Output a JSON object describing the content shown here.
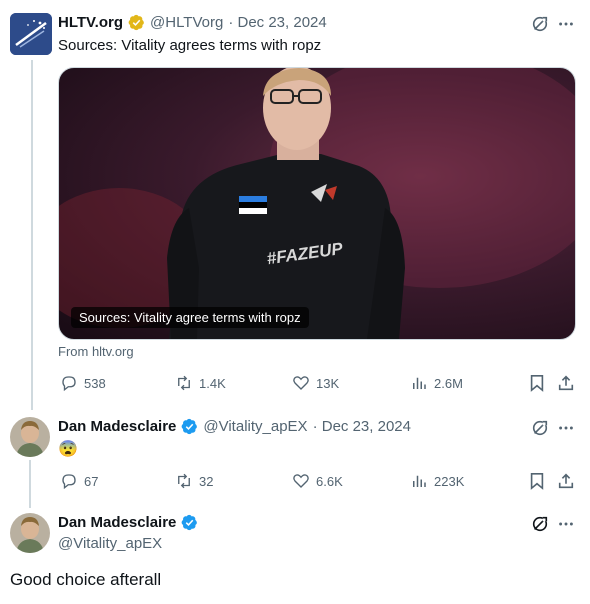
{
  "colors": {
    "accent": "#1d9bf0",
    "gold": "#e2b719",
    "muted": "#536471",
    "line": "#cfd9de"
  },
  "tweet1": {
    "name": "HLTV.org",
    "verified": "gold-verified-badge",
    "handle": "@HLTVorg",
    "date": "· Dec 23, 2024",
    "text": "Sources: Vitality agrees terms with ropz",
    "card": {
      "caption": "Sources: Vitality agree terms with ropz",
      "source": "From hltv.org"
    },
    "actions": {
      "replies": "538",
      "reposts": "1.4K",
      "likes": "13K",
      "views": "2.6M"
    }
  },
  "tweet2": {
    "name": "Dan Madesclaire",
    "verified": "blue-verified-badge",
    "handle": "@Vitality_apEX",
    "date": "· Dec 23, 2024",
    "text": "😨",
    "actions": {
      "replies": "67",
      "reposts": "32",
      "likes": "6.6K",
      "views": "223K"
    }
  },
  "tweet3": {
    "name": "Dan Madesclaire",
    "verified": "blue-verified-badge",
    "handle": "@Vitality_apEX",
    "text": "Good choice afterall"
  }
}
